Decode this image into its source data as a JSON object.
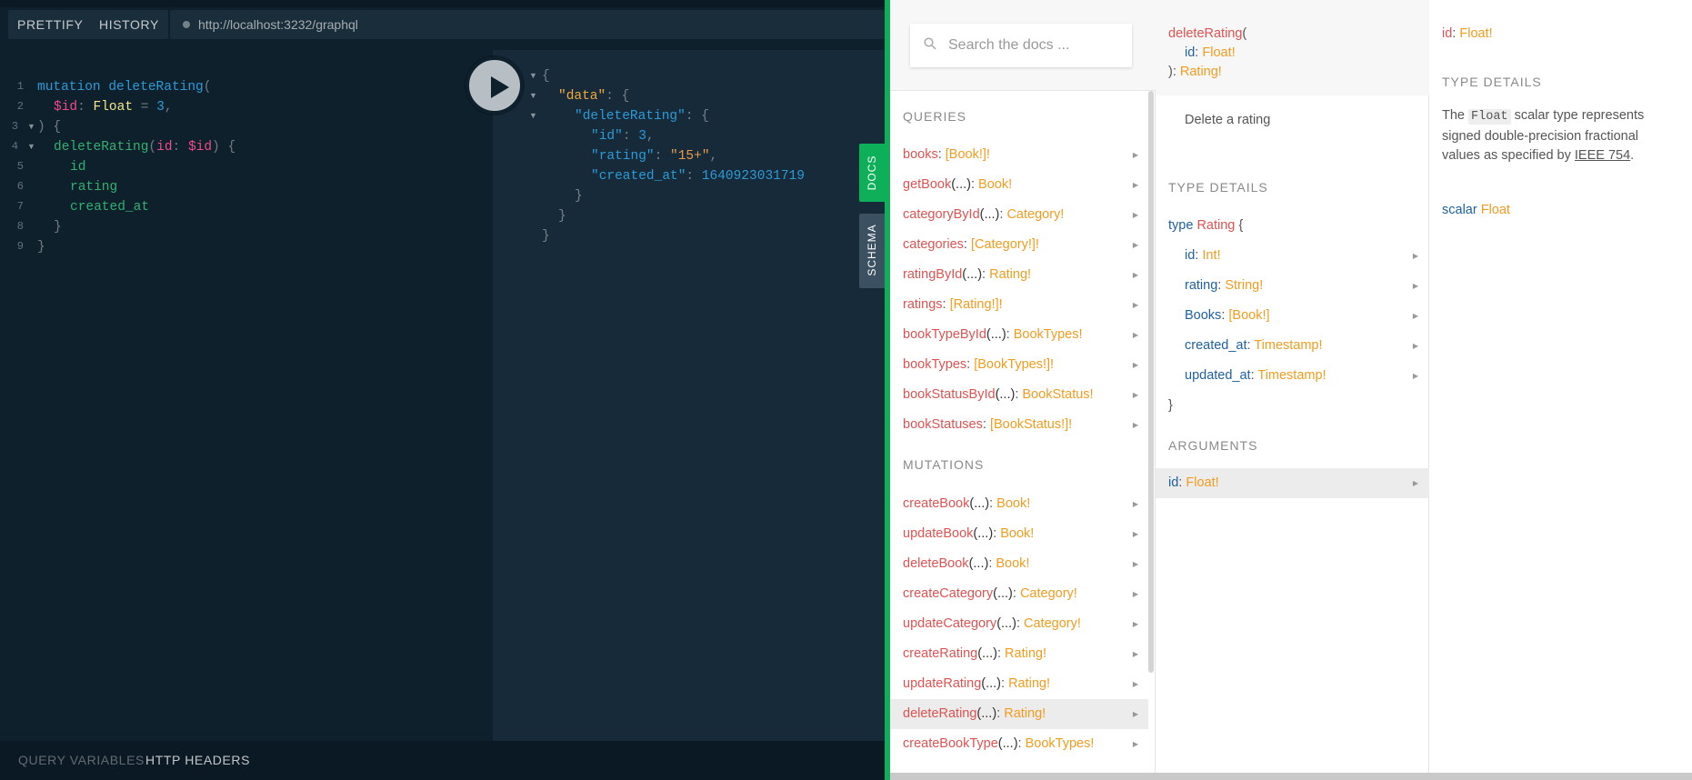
{
  "toolbar": {
    "prettify": "PRETTIFY",
    "history": "HISTORY",
    "url": "http://localhost:3232/graphql"
  },
  "editor": {
    "line_numbers": [
      "1",
      "2",
      "3",
      "4",
      "5",
      "6",
      "7",
      "8",
      "9"
    ],
    "query": {
      "l1_kw": "mutation",
      "l1_name": "deleteRating",
      "l1_paren": "(",
      "l2_var": "$id",
      "l2_colon": ":",
      "l2_type": "Float",
      "l2_eq": "=",
      "l2_num": "3",
      "l2_comma": ",",
      "l3": ") {",
      "l4_field": "deleteRating",
      "l4_paren": "(",
      "l4_arg": "id",
      "l4_colon": ":",
      "l4_var": "$id",
      "l4_close": ") {",
      "l5": "id",
      "l6": "rating",
      "l7": "created_at",
      "l8": "}",
      "l9": "}"
    }
  },
  "result": {
    "open": "{",
    "data_key": "\"data\"",
    "colon": ":",
    "brace": "{",
    "delete_key": "\"deleteRating\"",
    "id_key": "\"id\"",
    "id_val": "3",
    "rating_key": "\"rating\"",
    "rating_val": "\"15+\"",
    "created_key": "\"created_at\"",
    "created_val": "1640923031719",
    "comma": ",",
    "close": "}"
  },
  "side_tabs": {
    "docs": "DOCS",
    "schema": "SCHEMA"
  },
  "bottom": {
    "query_variables": "QUERY VARIABLES",
    "http_headers": "HTTP HEADERS"
  },
  "docs": {
    "search_placeholder": "Search the docs ...",
    "queries_title": "QUERIES",
    "mutations_title": "MUTATIONS",
    "queries": [
      {
        "name": "books",
        "args": "",
        "type": "[Book!]!"
      },
      {
        "name": "getBook",
        "args": "(...)",
        "type": "Book!"
      },
      {
        "name": "categoryById",
        "args": "(...)",
        "type": "Category!"
      },
      {
        "name": "categories",
        "args": "",
        "type": "[Category!]!"
      },
      {
        "name": "ratingById",
        "args": "(...)",
        "type": "Rating!"
      },
      {
        "name": "ratings",
        "args": "",
        "type": "[Rating!]!"
      },
      {
        "name": "bookTypeById",
        "args": "(...)",
        "type": "BookTypes!"
      },
      {
        "name": "bookTypes",
        "args": "",
        "type": "[BookTypes!]!"
      },
      {
        "name": "bookStatusById",
        "args": "(...)",
        "type": "BookStatus!"
      },
      {
        "name": "bookStatuses",
        "args": "",
        "type": "[BookStatus!]!"
      }
    ],
    "mutations": [
      {
        "name": "createBook",
        "args": "(...)",
        "type": "Book!"
      },
      {
        "name": "updateBook",
        "args": "(...)",
        "type": "Book!"
      },
      {
        "name": "deleteBook",
        "args": "(...)",
        "type": "Book!"
      },
      {
        "name": "createCategory",
        "args": "(...)",
        "type": "Category!"
      },
      {
        "name": "updateCategory",
        "args": "(...)",
        "type": "Category!"
      },
      {
        "name": "createRating",
        "args": "(...)",
        "type": "Rating!"
      },
      {
        "name": "updateRating",
        "args": "(...)",
        "type": "Rating!"
      },
      {
        "name": "deleteRating",
        "args": "(...)",
        "type": "Rating!"
      },
      {
        "name": "createBookType",
        "args": "(...)",
        "type": "BookTypes!"
      }
    ],
    "field_panel": {
      "name": "deleteRating",
      "open_paren": "(",
      "arg_name": "id",
      "arg_type": "Float!",
      "close": "):",
      "return_type": "Rating!",
      "description": "Delete a rating",
      "type_details_title": "TYPE DETAILS",
      "type_kw": "type",
      "type_name": "Rating",
      "type_open": "{",
      "type_close": "}",
      "fields": [
        {
          "name": "id",
          "type": "Int!"
        },
        {
          "name": "rating",
          "type": "String!"
        },
        {
          "name": "Books",
          "type": "[Book!]"
        },
        {
          "name": "created_at",
          "type": "Timestamp!"
        },
        {
          "name": "updated_at",
          "type": "Timestamp!"
        }
      ],
      "arguments_title": "ARGUMENTS",
      "argument": {
        "name": "id",
        "type": "Float!"
      }
    },
    "arg_panel": {
      "name": "id",
      "type": "Float!",
      "type_details_title": "TYPE DETAILS",
      "desc_pre": "The",
      "desc_code": "Float",
      "desc_mid": "scalar type represents signed double-precision fractional values as specified by",
      "desc_link": "IEEE 754",
      "desc_end": ".",
      "scalar_kw": "scalar",
      "scalar_name": "Float"
    }
  }
}
